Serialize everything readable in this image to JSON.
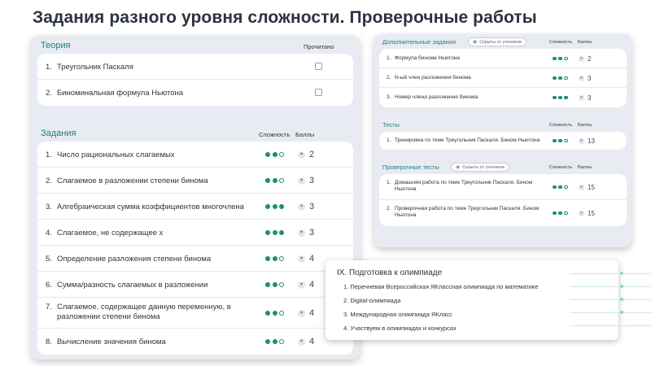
{
  "page_title": "Задания разного уровня сложности. Проверочные работы",
  "left": {
    "theory": {
      "label": "Теория",
      "read_label": "Прочитано",
      "items": [
        {
          "num": "1.",
          "text": "Треугольник Паскаля"
        },
        {
          "num": "2.",
          "text": "Биноминальная формула Ньютона"
        }
      ]
    },
    "tasks": {
      "label": "Задания",
      "difficulty_label": "Сложность",
      "points_label": "Баллы",
      "items": [
        {
          "num": "1.",
          "text": "Число рациональных слагаемых",
          "level": 2,
          "points": "2"
        },
        {
          "num": "2.",
          "text": "Слагаемое в разложении степени бинома",
          "level": 2,
          "points": "3"
        },
        {
          "num": "3.",
          "text": "Алгебраическая сумма коэффициентов многочлена",
          "level": 3,
          "points": "3"
        },
        {
          "num": "4.",
          "text": "Слагаемое, не содержащее x",
          "level": 3,
          "points": "3"
        },
        {
          "num": "5.",
          "text": "Определение разложения степени бинома",
          "level": 2,
          "points": "4"
        },
        {
          "num": "6.",
          "text": "Сумма/разность слагаемых в разложении",
          "level": 2,
          "points": "4"
        },
        {
          "num": "7.",
          "text": "Слагаемое, содержащее данную переменную, в разложении степени бинома",
          "level": 2,
          "points": "4"
        },
        {
          "num": "8.",
          "text": "Вычисление значения бинома",
          "level": 2,
          "points": "4"
        }
      ]
    }
  },
  "right": {
    "extra": {
      "label": "Дополнительные задания",
      "badge": "Скрыты от учеников",
      "difficulty_label": "Сложность",
      "points_label": "Баллы",
      "items": [
        {
          "num": "1.",
          "text": "Формула бинома Ньютона",
          "level": 2,
          "points": "2"
        },
        {
          "num": "2.",
          "text": "N-ый член разложения бинома",
          "level": 2,
          "points": "3"
        },
        {
          "num": "3.",
          "text": "Номер члена разложения бинома",
          "level": 3,
          "points": "3"
        }
      ]
    },
    "tests": {
      "label": "Тесты",
      "difficulty_label": "Сложность",
      "points_label": "Баллы",
      "items": [
        {
          "num": "1.",
          "text": "Тренировка по теме Треугольник Паскаля. Бином Ньютона",
          "level": 2,
          "points": "13"
        }
      ]
    },
    "checks": {
      "label": "Проверочные тесты",
      "badge": "Скрыты от учеников",
      "difficulty_label": "Сложность",
      "points_label": "Баллы",
      "items": [
        {
          "num": "1.",
          "text": "Домашняя работа по теме Треугольник Паскаля. Бином Ньютона",
          "level": 2,
          "points": "15"
        },
        {
          "num": "2.",
          "text": "Проверочная работа по теме Треугольник Паскаля. Бином Ньютона",
          "level": 2,
          "points": "15"
        }
      ]
    }
  },
  "olympiad": {
    "title": "IX. Подготовка к олимпиаде",
    "items": [
      {
        "num": "1.",
        "text": "Перечневая Всероссийская ЯКлассная олимпиада по математике"
      },
      {
        "num": "2.",
        "text": "Digital-олимпиада"
      },
      {
        "num": "3.",
        "text": "Международная олимпиада ЯКласс"
      },
      {
        "num": "4.",
        "text": "Участвуем в олимпиадах и конкурсах"
      }
    ]
  },
  "colors": {
    "accent": "#1f8d76",
    "section_label": "#1e7f7d",
    "panel_bg": "#e8ebf2"
  }
}
